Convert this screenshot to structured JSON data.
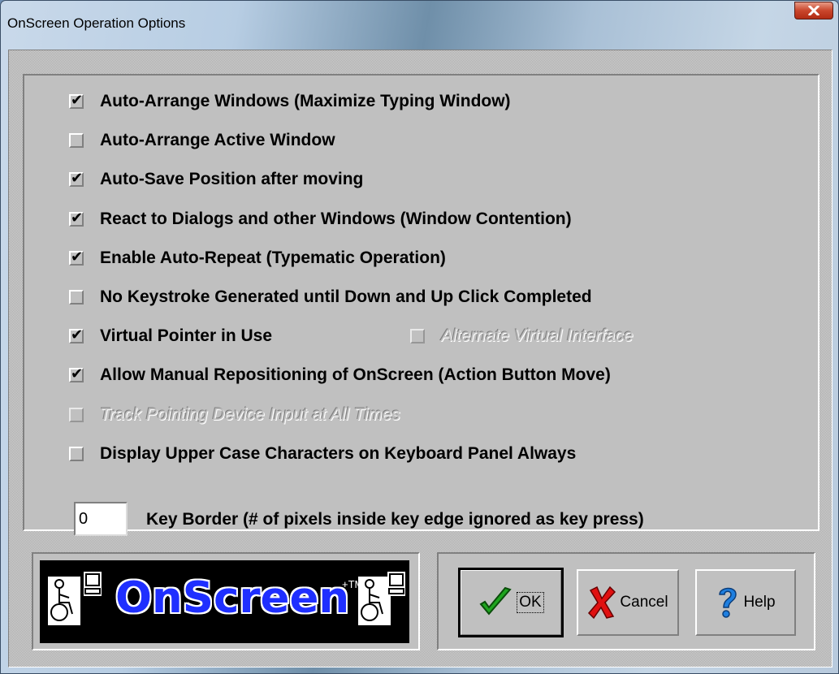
{
  "window": {
    "title": "OnScreen Operation Options",
    "close_label": "X"
  },
  "options": [
    {
      "label": "Auto-Arrange Windows (Maximize Typing Window)",
      "checked": true,
      "enabled": true
    },
    {
      "label": "Auto-Arrange Active Window",
      "checked": false,
      "enabled": true
    },
    {
      "label": "Auto-Save Position after moving",
      "checked": true,
      "enabled": true
    },
    {
      "label": "React to Dialogs and other Windows (Window Contention)",
      "checked": true,
      "enabled": true
    },
    {
      "label": "Enable Auto-Repeat (Typematic Operation)",
      "checked": true,
      "enabled": true
    },
    {
      "label": "No Keystroke Generated until Down and Up Click Completed",
      "checked": false,
      "enabled": true
    },
    {
      "label": "Virtual Pointer in Use",
      "checked": true,
      "enabled": true
    },
    {
      "label": "Alternate Virtual Interface",
      "checked": false,
      "enabled": false
    },
    {
      "label": "Allow Manual Repositioning of OnScreen (Action Button Move)",
      "checked": true,
      "enabled": true
    },
    {
      "label": "Track Pointing Device Input at All Times",
      "checked": false,
      "enabled": false
    },
    {
      "label": "Display Upper Case Characters on Keyboard Panel Always",
      "checked": false,
      "enabled": true
    }
  ],
  "key_border": {
    "value": "0",
    "label": "Key Border (# of pixels inside key edge ignored as key press)"
  },
  "logo": {
    "text": "OnScreen",
    "mark": "+TM"
  },
  "buttons": {
    "ok": "OK",
    "cancel": "Cancel",
    "help": "Help"
  },
  "check_glyph": "✔",
  "colors": {
    "logo_blue": "#1f2fff",
    "ok_green": "#1fa51f",
    "cancel_red": "#e01010",
    "help_blue": "#1e7fe0"
  }
}
